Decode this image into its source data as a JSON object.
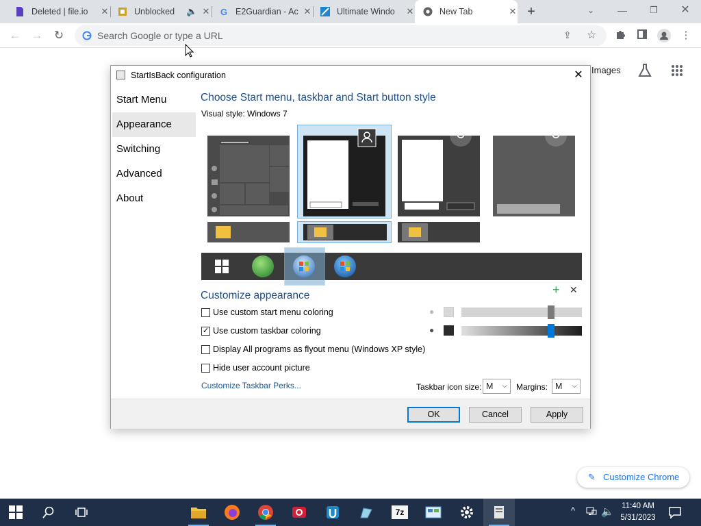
{
  "browser": {
    "tabs": [
      {
        "title": "Deleted | file.io",
        "favicon": "file-io-icon",
        "color": "#5a3fc0"
      },
      {
        "title": "Unblocked",
        "favicon": "unblocked-icon",
        "color": "#c9a227",
        "muted": true
      },
      {
        "title": "E2Guardian - Ac",
        "favicon": "google-icon",
        "color": "#4285f4"
      },
      {
        "title": "Ultimate Windo",
        "favicon": "ultimate-windows-icon",
        "color": "#1c86d1"
      },
      {
        "title": "New Tab",
        "favicon": "chrome-icon",
        "color": "#5f6368",
        "active": true
      }
    ],
    "new_tab_label": "+",
    "omnibox_placeholder": "Search Google or type a URL",
    "page_images_link": "Images",
    "customize_chrome": "Customize Chrome"
  },
  "dialog": {
    "title": "StartIsBack configuration",
    "nav": [
      "Start Menu",
      "Appearance",
      "Switching",
      "Advanced",
      "About"
    ],
    "selected_nav": "Appearance",
    "heading": "Choose Start menu, taskbar and Start button style",
    "visual_style_label": "Visual style:",
    "visual_style_value": "Windows 7",
    "customize_heading": "Customize appearance",
    "options": [
      {
        "label": "Use custom start menu coloring",
        "checked": false
      },
      {
        "label": "Use custom taskbar coloring",
        "checked": true
      },
      {
        "label": "Display All programs as flyout menu (Windows XP style)",
        "checked": false
      },
      {
        "label": "Hide user account picture",
        "checked": false
      }
    ],
    "perks_link": "Customize Taskbar Perks...",
    "icon_size_label": "Taskbar icon size:",
    "icon_size_value": "M",
    "margins_label": "Margins:",
    "margins_value": "M",
    "buttons": {
      "ok": "OK",
      "cancel": "Cancel",
      "apply": "Apply"
    },
    "slider_levels": {
      "start_menu": 0.76,
      "taskbar": 0.76
    },
    "colors": {
      "accent": "#0078d7",
      "heading": "#1e4e8c",
      "link": "#1a5a9a",
      "swatch_start": "#d8d8d8",
      "swatch_taskbar": "#2b2b2b"
    }
  },
  "taskbar": {
    "time": "11:40 AM",
    "date": "5/31/2023",
    "items": [
      "windows-start-icon",
      "search-icon",
      "task-view-icon",
      "file-explorer-icon",
      "firefox-icon",
      "chrome-icon",
      "app-red-icon",
      "app-blue-icon",
      "app-pen-icon",
      "7zip-icon",
      "control-panel-icon",
      "settings-gear-icon",
      "startisback-icon"
    ],
    "seven_zip_label": "7z"
  }
}
